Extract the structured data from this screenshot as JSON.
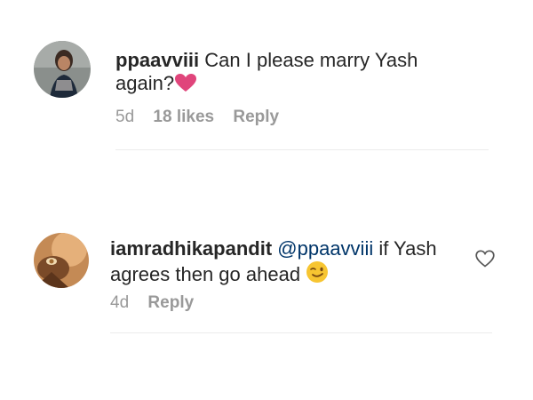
{
  "comments": [
    {
      "username": "ppaavviii",
      "text_line1": "Can I please marry Yash",
      "text_line2": "again?",
      "emoji": "pink-heart",
      "time": "5d",
      "likes": "18 likes",
      "reply_label": "Reply"
    },
    {
      "username": "iamradhikapandit",
      "mention": "@ppaavviii",
      "text_line1": "if Yash",
      "text_line2": "agrees then go ahead",
      "emoji": "winking-face",
      "time": "4d",
      "reply_label": "Reply"
    }
  ],
  "colors": {
    "mention": "#003569",
    "heart": "#e0457b",
    "meta": "#999999",
    "text": "#262626"
  }
}
